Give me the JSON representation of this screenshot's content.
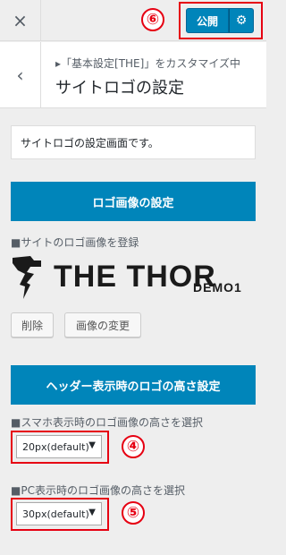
{
  "topbar": {
    "close_icon": "×",
    "publish_label": "公開",
    "gear_icon": "⚙",
    "annotation_number": "⑥"
  },
  "section": {
    "back_icon": "‹",
    "breadcrumb": "▸「基本設定[THE]」をカスタマイズ中",
    "title": "サイトロゴの設定"
  },
  "description": "サイトロゴの設定画面です。",
  "logo_section": {
    "heading": "ロゴ画像の設定",
    "label": "■サイトのロゴ画像を登録",
    "logo_text": "THE THOR",
    "logo_suffix": "DEMO1",
    "remove_label": "削除",
    "change_label": "画像の変更"
  },
  "height_section": {
    "heading": "ヘッダー表示時のロゴの高さ設定",
    "mobile_label": "■スマホ表示時のロゴ画像の高さを選択",
    "mobile_value": "20px(default)",
    "mobile_annotation": "④",
    "pc_label": "■PC表示時のロゴ画像の高さを選択",
    "pc_value": "30px(default)",
    "pc_annotation": "⑤"
  },
  "colors": {
    "accent": "#0085ba",
    "annotation": "#e60012",
    "background": "#eeeeee"
  }
}
